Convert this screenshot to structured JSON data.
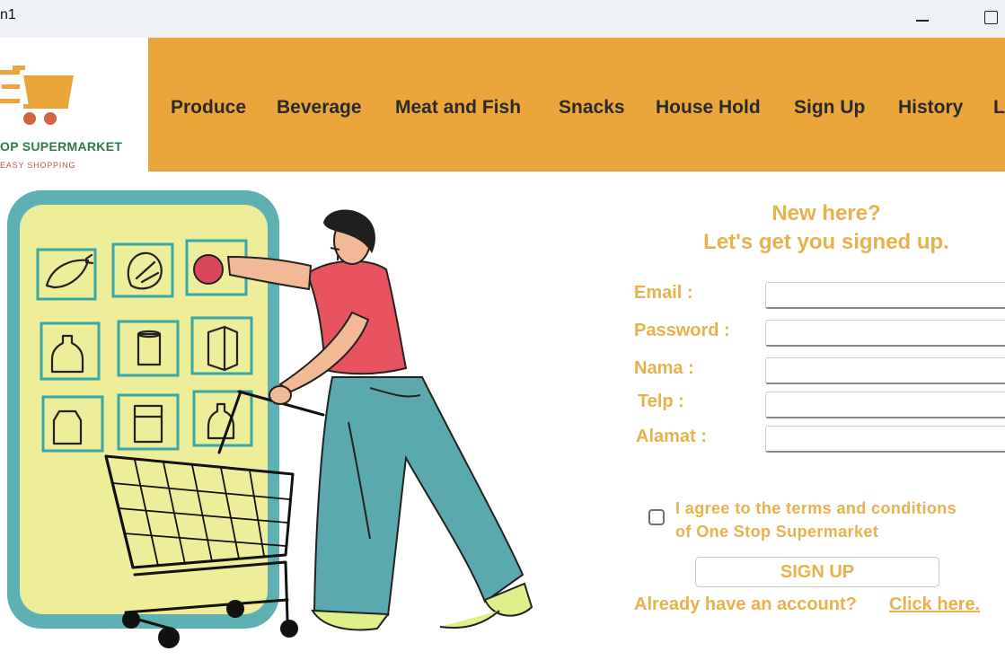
{
  "window": {
    "title": "n1"
  },
  "brand": {
    "name": "OP SUPERMARKET",
    "tagline": "EASY SHOPPING"
  },
  "nav": {
    "items": [
      {
        "label": "Produce"
      },
      {
        "label": "Beverage"
      },
      {
        "label": "Meat and Fish"
      },
      {
        "label": "Snacks"
      },
      {
        "label": "House Hold"
      },
      {
        "label": "Sign Up"
      },
      {
        "label": "History"
      },
      {
        "label": "L"
      }
    ]
  },
  "form": {
    "heading_1": "New here?",
    "heading_2": "Let's get you signed up.",
    "fields": [
      {
        "label": "Email :",
        "value": ""
      },
      {
        "label": "Password :",
        "value": ""
      },
      {
        "label": "Nama :",
        "value": ""
      },
      {
        "label": "Telp :",
        "value": ""
      },
      {
        "label": "Alamat :",
        "value": ""
      }
    ],
    "agree_line_1": "I agree to the terms and conditions",
    "agree_line_2": "of One Stop Supermarket",
    "agree_checked": false,
    "submit_label": "SIGN UP",
    "already_text": "Already have an account?",
    "login_link": "Click here."
  },
  "colors": {
    "accent": "#eaa63b",
    "form_text": "#e8b14c",
    "brand_green": "#2f7a4a",
    "tagline_red": "#c94b55"
  },
  "icons": [
    "minimize-icon",
    "maximize-icon",
    "cart-logo-icon",
    "shopper-illustration"
  ]
}
